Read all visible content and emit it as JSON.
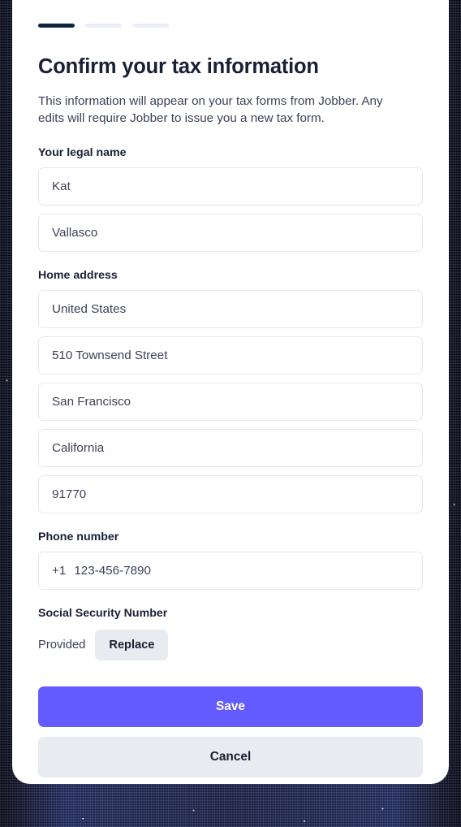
{
  "progress": {
    "steps": [
      {
        "state": "active"
      },
      {
        "state": "inactive"
      },
      {
        "state": "inactive"
      }
    ],
    "active_color": "#0d2440",
    "inactive_color": "#e9eef7"
  },
  "header": {
    "title": "Confirm your tax information",
    "subtitle": "This information will appear on your tax forms from Jobber. Any edits will require Jobber to issue you a new tax form."
  },
  "legal_name": {
    "label": "Your legal name",
    "first_name": "Kat",
    "last_name": "Vallasco"
  },
  "home_address": {
    "label": "Home address",
    "country": "United States",
    "line1": "510 Townsend Street",
    "city": "San Francisco",
    "state": "California",
    "postal_code": "91770"
  },
  "phone": {
    "label": "Phone number",
    "country_code": "+1",
    "number": "123-456-7890"
  },
  "ssn": {
    "label": "Social Security Number",
    "status": "Provided",
    "replace_label": "Replace"
  },
  "actions": {
    "save_label": "Save",
    "cancel_label": "Cancel",
    "save_color": "#635bff",
    "cancel_color": "#e8ebef"
  }
}
